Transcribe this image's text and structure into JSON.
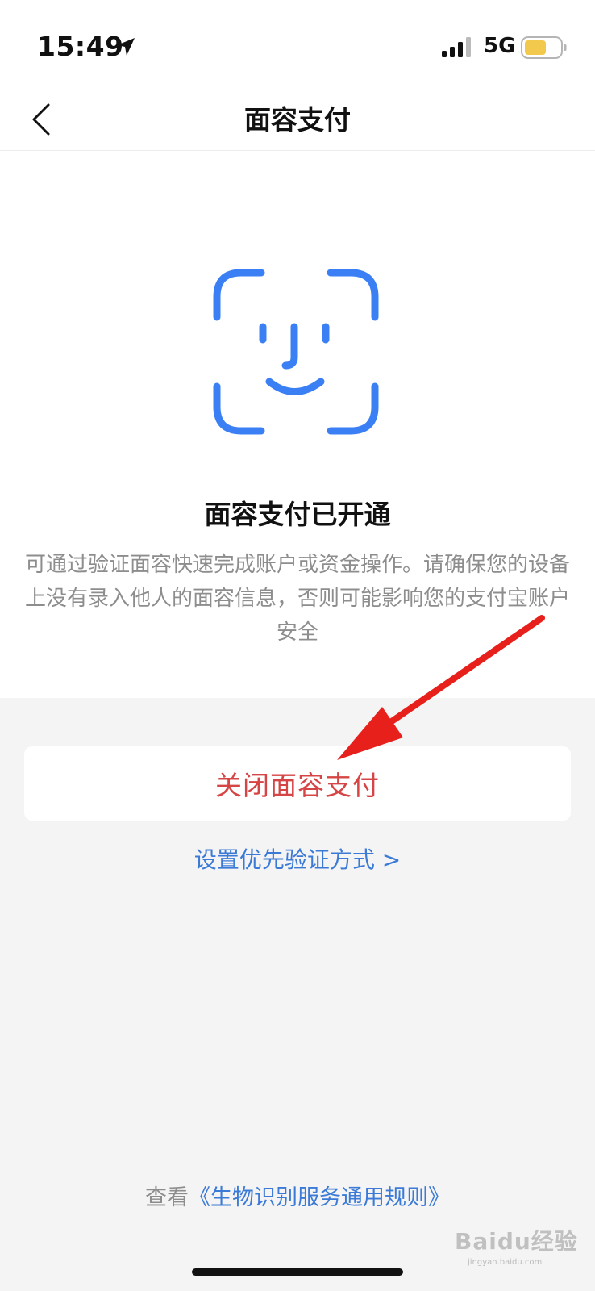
{
  "status_bar": {
    "time": "15:49",
    "network": "5G",
    "battery_color": "#f2c94c",
    "icons": [
      "location-arrow-icon",
      "signal-icon",
      "battery-icon"
    ]
  },
  "nav": {
    "title": "面容支付",
    "back_icon": "chevron-left-icon"
  },
  "hero": {
    "icon": "face-id-icon",
    "icon_color": "#3a80f4",
    "title": "面容支付已开通",
    "description": "可通过验证面容快速完成账户或资金操作。请确保您的设备上没有录入他人的面容信息，否则可能影响您的支付宝账户安全"
  },
  "actions": {
    "disable_label": "关闭面容支付",
    "disable_color": "#d64545",
    "priority_link": "设置优先验证方式 >",
    "link_color": "#3b7ad6"
  },
  "footer": {
    "rules_prefix": "查看",
    "rules_link": "《生物识别服务通用规则》"
  },
  "annotation": {
    "arrow_color": "#e8201c"
  },
  "watermark": {
    "brand": "Baidu经验",
    "sub": "jingyan.baidu.com"
  }
}
